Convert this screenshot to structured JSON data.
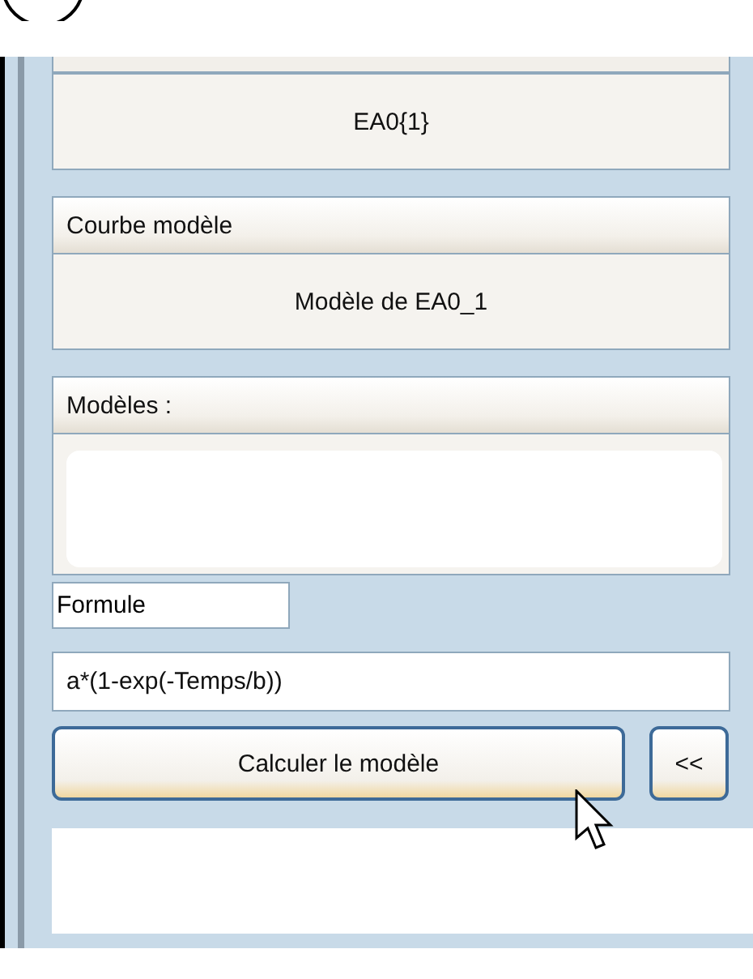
{
  "source_box": {
    "value": "EA0{1}"
  },
  "model_curve": {
    "title": "Courbe modèle",
    "value": "Modèle de EA0_1"
  },
  "models": {
    "title": "Modèles :"
  },
  "formula_label": {
    "value": "Formule"
  },
  "formula": {
    "value": "a*(1-exp(-Temps/b))"
  },
  "buttons": [
    {
      "kind": "wide",
      "label": "Calculer le modèle"
    },
    {
      "kind": "small",
      "label": "<<"
    }
  ]
}
